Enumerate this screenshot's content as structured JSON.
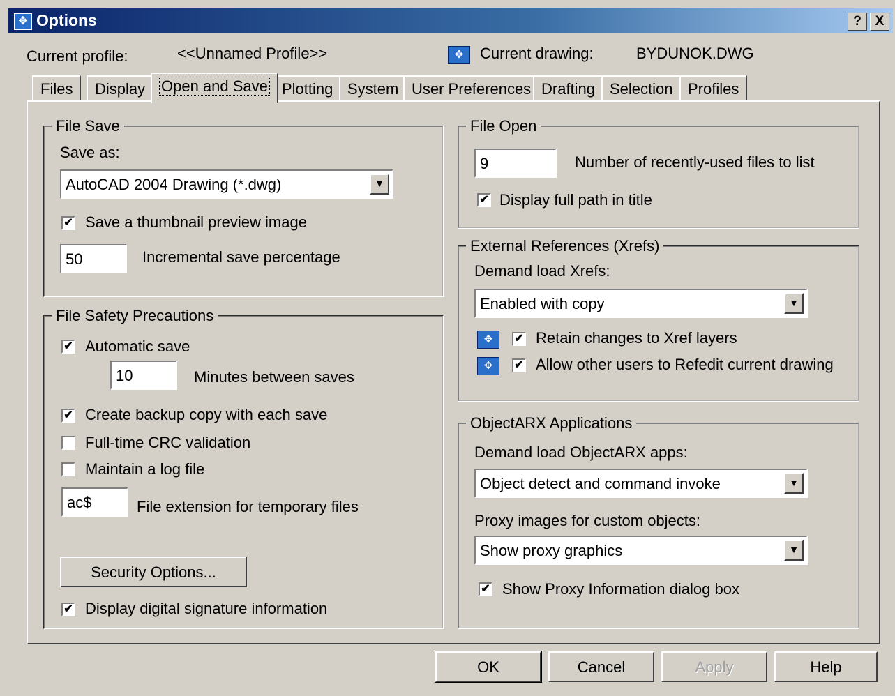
{
  "window": {
    "title": "Options",
    "help_btn": "?",
    "close_btn": "X"
  },
  "profile": {
    "label": "Current profile:",
    "value": "<<Unnamed Profile>>",
    "drawing_label": "Current drawing:",
    "drawing_value": "BYDUNOK.DWG"
  },
  "tabs": [
    "Files",
    "Display",
    "Open and Save",
    "Plotting",
    "System",
    "User Preferences",
    "Drafting",
    "Selection",
    "Profiles"
  ],
  "file_save": {
    "title": "File Save",
    "save_as_label": "Save as:",
    "save_as_value": "AutoCAD 2004 Drawing (*.dwg)",
    "thumbnail_label": "Save a thumbnail preview image",
    "thumbnail_checked": true,
    "incremental_value": "50",
    "incremental_label": "Incremental save percentage"
  },
  "safety": {
    "title": "File Safety Precautions",
    "autosave_label": "Automatic save",
    "autosave_checked": true,
    "minutes_value": "10",
    "minutes_label": "Minutes between saves",
    "backup_label": "Create backup copy with each save",
    "backup_checked": true,
    "crc_label": "Full-time CRC validation",
    "crc_checked": false,
    "log_label": "Maintain a log file",
    "log_checked": false,
    "ext_value": "ac$",
    "ext_label": "File extension for temporary files",
    "security_button": "Security Options...",
    "signature_label": "Display digital signature information",
    "signature_checked": true
  },
  "file_open": {
    "title": "File Open",
    "recent_value": "9",
    "recent_label": "Number of recently-used files to list",
    "fullpath_label": "Display full path in title",
    "fullpath_checked": true
  },
  "xrefs": {
    "title": "External References (Xrefs)",
    "demand_label": "Demand load Xrefs:",
    "demand_value": "Enabled with copy",
    "retain_label": "Retain changes to Xref layers",
    "retain_checked": true,
    "refedit_label": "Allow other users to Refedit current drawing",
    "refedit_checked": true
  },
  "arx": {
    "title": "ObjectARX Applications",
    "demand_label": "Demand load ObjectARX apps:",
    "demand_value": "Object detect and command invoke",
    "proxy_label": "Proxy images for custom objects:",
    "proxy_value": "Show proxy graphics",
    "proxy_info_label": "Show Proxy Information dialog box",
    "proxy_info_checked": true
  },
  "buttons": {
    "ok": "OK",
    "cancel": "Cancel",
    "apply": "Apply",
    "help": "Help"
  },
  "icons": {
    "app": "options-icon",
    "drawing": "drawing-icon",
    "xref": "xref-saved-icon"
  },
  "colors": {
    "face": "#d4d0c8",
    "title_start": "#0a246a",
    "title_end": "#a6caf0",
    "icon_blue": "#2a6fc9"
  }
}
